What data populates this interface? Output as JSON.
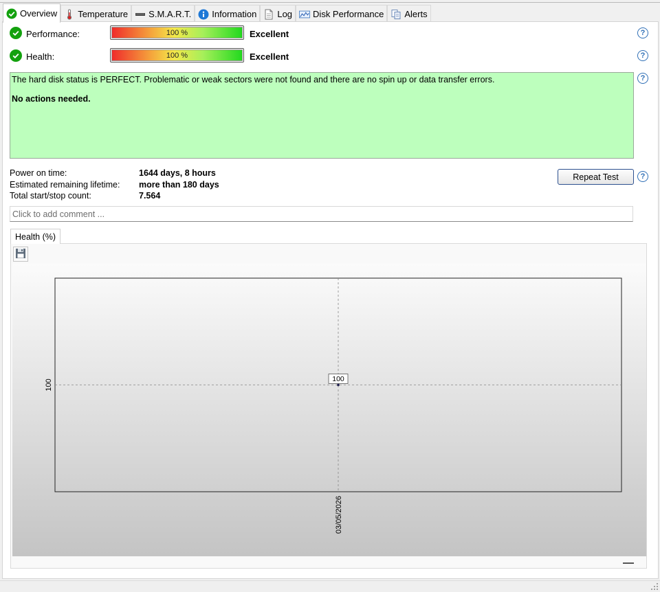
{
  "tabs": [
    {
      "label": "Overview",
      "icon": "check-circle-icon",
      "active": true
    },
    {
      "label": "Temperature",
      "icon": "thermometer-icon"
    },
    {
      "label": "S.M.A.R.T.",
      "icon": "drive-icon"
    },
    {
      "label": "Information",
      "icon": "info-icon"
    },
    {
      "label": "Log",
      "icon": "document-icon"
    },
    {
      "label": "Disk Performance",
      "icon": "performance-chart-icon"
    },
    {
      "label": "Alerts",
      "icon": "alerts-icon"
    }
  ],
  "performance": {
    "label": "Performance:",
    "percent_text": "100 %",
    "value": 100,
    "rating": "Excellent"
  },
  "health": {
    "label": "Health:",
    "percent_text": "100 %",
    "value": 100,
    "rating": "Excellent"
  },
  "status": {
    "message": "The hard disk status is PERFECT. Problematic or weak sectors were not found and there are no spin up or data transfer errors.",
    "action": "No actions needed.",
    "background": "#bdffbd"
  },
  "info": {
    "power_on_label": "Power on time:",
    "power_on_value": "1644 days, 8 hours",
    "lifetime_label": "Estimated remaining lifetime:",
    "lifetime_value": "more than 180 days",
    "startstop_label": "Total start/stop count:",
    "startstop_value": "7.564"
  },
  "repeat_test_label": "Repeat Test",
  "help_glyph": "?",
  "comment_placeholder": "Click to add comment ...",
  "chart_tab_label": "Health (%)",
  "colors": {
    "accent": "#2f6fb6",
    "ok_green": "#13a10e",
    "status_green": "#bdffbd"
  },
  "chart_data": {
    "type": "line",
    "title": "",
    "xlabel": "",
    "ylabel": "",
    "x": [
      "03/05/2026"
    ],
    "series": [
      {
        "values": [
          100
        ]
      }
    ],
    "point_labels": [
      "100"
    ],
    "y_tick_labels": [
      "100"
    ],
    "grid": true
  }
}
